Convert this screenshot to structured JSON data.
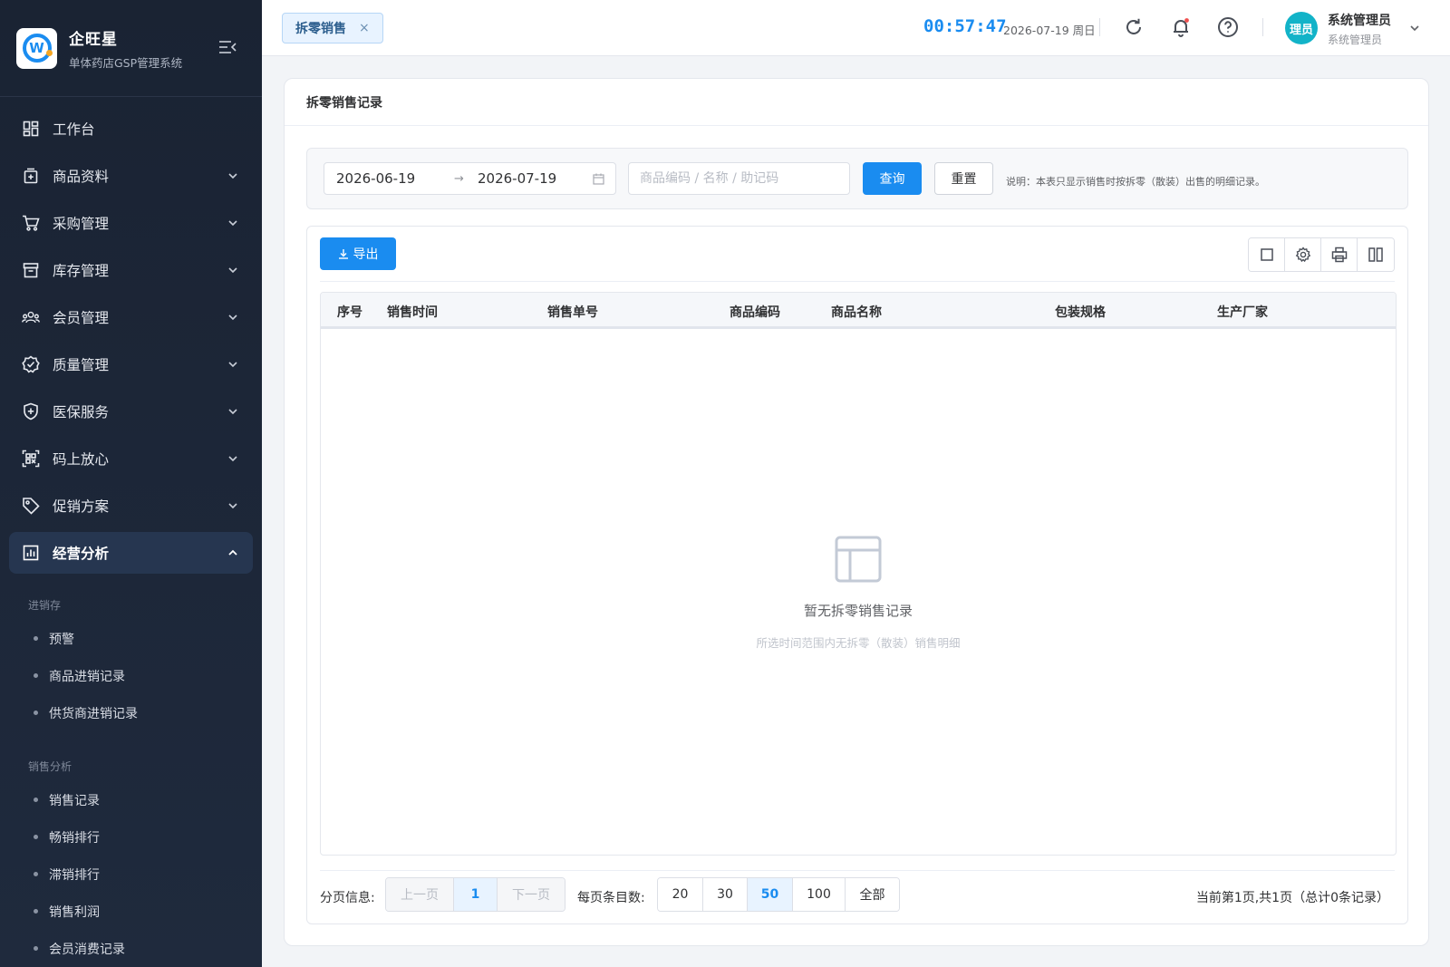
{
  "brand": {
    "name": "企旺星",
    "subtitle": "单体药店GSP管理系统",
    "logo_letter": "W"
  },
  "colors": {
    "accent": "#1a8cf0",
    "sidebar_bg": "#1a2333",
    "avatar_bg": "#12b3c8"
  },
  "sidebar": {
    "items": [
      {
        "label": "工作台",
        "icon": "dashboard-icon"
      },
      {
        "label": "商品资料",
        "icon": "product-icon"
      },
      {
        "label": "采购管理",
        "icon": "cart-icon"
      },
      {
        "label": "库存管理",
        "icon": "archive-icon"
      },
      {
        "label": "会员管理",
        "icon": "members-icon"
      },
      {
        "label": "质量管理",
        "icon": "quality-badge-icon"
      },
      {
        "label": "医保服务",
        "icon": "shield-plus-icon"
      },
      {
        "label": "码上放心",
        "icon": "qrcode-icon"
      },
      {
        "label": "促销方案",
        "icon": "tag-icon"
      },
      {
        "label": "经营分析",
        "icon": "chart-icon"
      }
    ],
    "groups": [
      {
        "title": "进销存",
        "items": [
          "预警",
          "商品进销记录",
          "供货商进销记录"
        ]
      },
      {
        "title": "销售分析",
        "items": [
          "销售记录",
          "畅销排行",
          "滞销排行",
          "销售利润",
          "会员消费记录"
        ]
      }
    ]
  },
  "topbar": {
    "tab_label": "拆零销售",
    "tab_close": "×",
    "clock": "00:57:47",
    "date": "2026-07-19 周日",
    "avatar_text": "理员",
    "user_name": "系统管理员",
    "user_role": "系统管理员"
  },
  "page": {
    "title": "拆零销售记录",
    "filter": {
      "start_date": "2026-06-19",
      "date_separator": "→",
      "end_date": "2026-07-19",
      "search_placeholder": "商品编码 / 名称 / 助记码",
      "search_value": "",
      "query_label": "查询",
      "reset_label": "重置",
      "note": "说明：本表只显示销售时按拆零（散装）出售的明细记录。"
    },
    "export_label": "导出",
    "table": {
      "columns": [
        "序号",
        "销售时间",
        "销售单号",
        "商品编码",
        "商品名称",
        "包装规格",
        "生产厂家"
      ],
      "rows": [],
      "empty_title": "暂无拆零销售记录",
      "empty_sub": "所选时间范围内无拆零（散装）销售明细"
    },
    "pager": {
      "label": "分页信息:",
      "prev": "上一页",
      "current": "1",
      "next": "下一页",
      "per_page_label": "每页条目数:",
      "sizes": [
        "20",
        "30",
        "50",
        "100",
        "全部"
      ],
      "selected_size": "50",
      "info": "当前第1页,共1页（总计0条记录）"
    }
  }
}
